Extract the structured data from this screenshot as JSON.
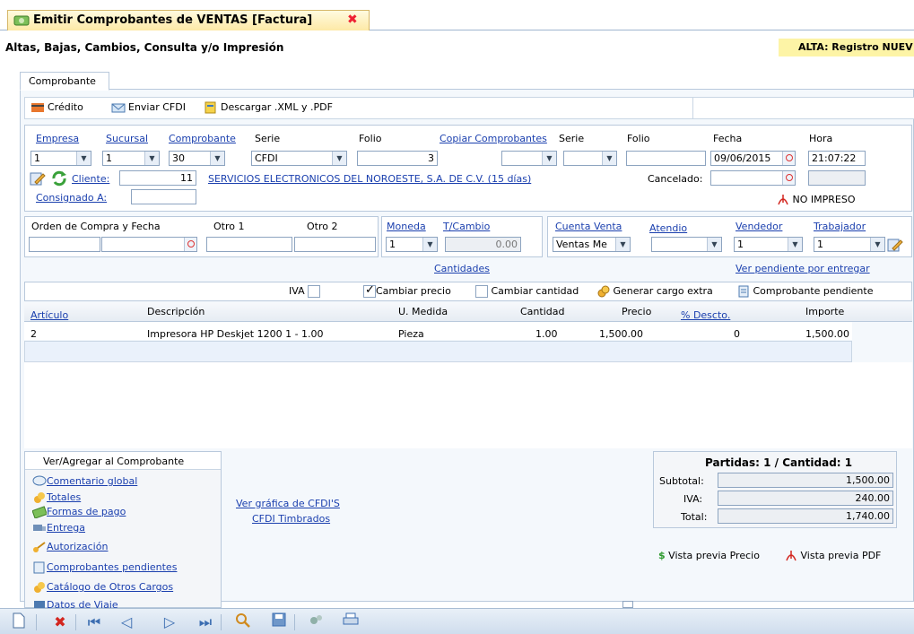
{
  "window": {
    "tab_title": "Emitir Comprobantes de VENTAS [Factura]",
    "subtitle": "Altas, Bajas, Cambios, Consulta y/o Impresión",
    "mode": "ALTA: Registro NUEV"
  },
  "section_tab": "Comprobante",
  "toolbar": {
    "credito": "Crédito",
    "enviar": "Enviar CFDI",
    "descargar": "Descargar .XML y .PDF"
  },
  "header": {
    "empresa_label": "Empresa",
    "sucursal_label": "Sucursal",
    "comprobante_label": "Comprobante",
    "serie_label": "Serie",
    "folio_label": "Folio",
    "copiar_label": "Copiar Comprobantes",
    "serie2_label": "Serie",
    "folio2_label": "Folio",
    "fecha_label": "Fecha",
    "hora_label": "Hora",
    "empresa": "1",
    "sucursal": "1",
    "comprobante": "30",
    "serie": "CFDI",
    "folio": "3",
    "fecha": "09/06/2015",
    "hora": "21:07:22",
    "cliente_label": "Cliente:",
    "cliente_num": "11",
    "cliente_name": "SERVICIOS ELECTRONICOS DEL NOROESTE, S.A. DE C.V. (15 días)",
    "cancelado_label": "Cancelado:",
    "consignado_label": "Consignado A:",
    "no_impreso": "NO IMPRESO"
  },
  "second": {
    "orden_label": "Orden de Compra y Fecha",
    "otro1_label": "Otro 1",
    "otro2_label": "Otro 2",
    "moneda_label": "Moneda",
    "tcambio_label": "T/Cambio",
    "moneda": "1",
    "tcambio": "0.00",
    "cuenta_label": "Cuenta Venta",
    "atendio_label": "Atendio",
    "vendedor_label": "Vendedor",
    "trabajador_label": "Trabajador",
    "cuenta": "Ventas Me",
    "vendedor": "1",
    "trabajador": "1",
    "cantidades": "Cantidades",
    "pendiente": "Ver pendiente por entregar"
  },
  "options": {
    "iva": "IVA",
    "cambiar_precio": "Cambiar precio",
    "cambiar_cantidad": "Cambiar cantidad",
    "generar_cargo": "Generar cargo extra",
    "comp_pendiente": "Comprobante pendiente"
  },
  "table": {
    "headers": [
      "Artículo",
      "Descripción",
      "U. Medida",
      "Cantidad",
      "Precio",
      "% Descto.",
      "Importe"
    ],
    "rows": [
      [
        "2",
        "Impresora HP Deskjet 1200  1 - 1.00",
        "Pieza",
        "1.00",
        "1,500.00",
        "0",
        "1,500.00"
      ]
    ]
  },
  "sidebar": {
    "title": "Ver/Agregar al Comprobante",
    "items": [
      "Comentario global",
      "Totales",
      "Formas de pago",
      "Entrega",
      "Autorización",
      "Comprobantes pendientes",
      "Catálogo de Otros Cargos",
      "Datos de Viaje"
    ]
  },
  "center_links": {
    "grafica": "Ver gráfica de CFDI'S",
    "timbrados": "CFDI Timbrados"
  },
  "totals": {
    "title": "Partidas: 1 / Cantidad: 1",
    "subtotal_label": "Subtotal:",
    "subtotal": "1,500.00",
    "iva_label": "IVA:",
    "iva": "240.00",
    "total_label": "Total:",
    "total": "1,740.00"
  },
  "preview": {
    "precio": "Vista previa Precio",
    "pdf": "Vista previa PDF"
  }
}
